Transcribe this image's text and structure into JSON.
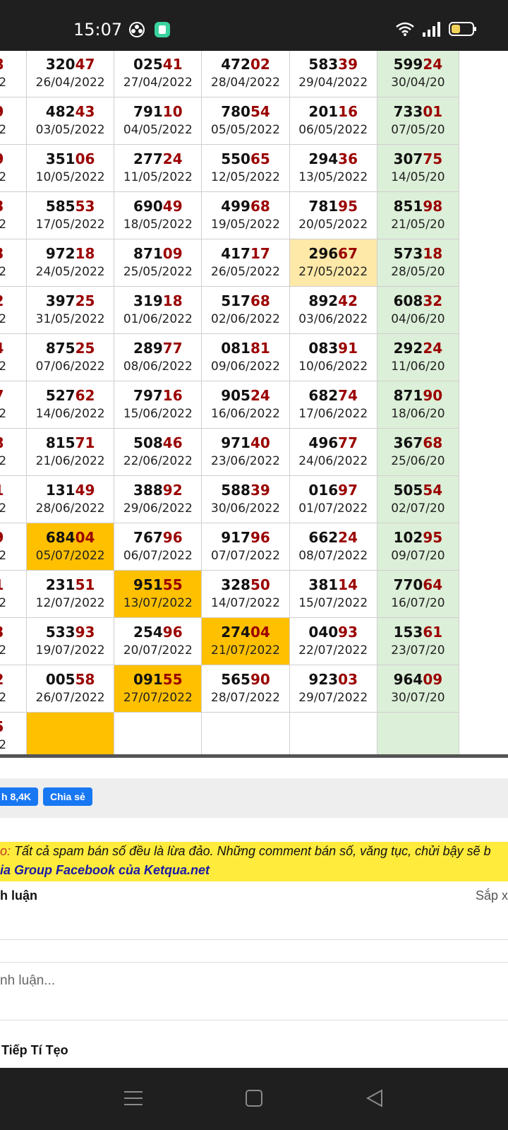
{
  "status": {
    "time": "15:07"
  },
  "rows": [
    [
      {
        "n": "368",
        "d": "/2022"
      },
      {
        "n": "32047",
        "d": "26/04/2022"
      },
      {
        "n": "02541",
        "d": "27/04/2022"
      },
      {
        "n": "47202",
        "d": "28/04/2022"
      },
      {
        "n": "58339",
        "d": "29/04/2022"
      },
      {
        "n": "59924",
        "d": "30/04/20"
      }
    ],
    [
      {
        "n": "479",
        "d": "/2022"
      },
      {
        "n": "48243",
        "d": "03/05/2022"
      },
      {
        "n": "79110",
        "d": "04/05/2022"
      },
      {
        "n": "78054",
        "d": "05/05/2022"
      },
      {
        "n": "20116",
        "d": "06/05/2022"
      },
      {
        "n": "73301",
        "d": "07/05/20"
      }
    ],
    [
      {
        "n": "559",
        "d": "/2022"
      },
      {
        "n": "35106",
        "d": "10/05/2022"
      },
      {
        "n": "27724",
        "d": "11/05/2022"
      },
      {
        "n": "55065",
        "d": "12/05/2022"
      },
      {
        "n": "29436",
        "d": "13/05/2022"
      },
      {
        "n": "30775",
        "d": "14/05/20"
      }
    ],
    [
      {
        "n": "713",
        "d": "/2022"
      },
      {
        "n": "58553",
        "d": "17/05/2022"
      },
      {
        "n": "69049",
        "d": "18/05/2022"
      },
      {
        "n": "49968",
        "d": "19/05/2022"
      },
      {
        "n": "78195",
        "d": "20/05/2022"
      },
      {
        "n": "85198",
        "d": "21/05/20"
      }
    ],
    [
      {
        "n": "213",
        "d": "/2022"
      },
      {
        "n": "97218",
        "d": "24/05/2022"
      },
      {
        "n": "87109",
        "d": "25/05/2022"
      },
      {
        "n": "41717",
        "d": "26/05/2022"
      },
      {
        "n": "29667",
        "d": "27/05/2022",
        "hl": "light"
      },
      {
        "n": "57318",
        "d": "28/05/20"
      }
    ],
    [
      {
        "n": "512",
        "d": "/2022"
      },
      {
        "n": "39725",
        "d": "31/05/2022"
      },
      {
        "n": "31918",
        "d": "01/06/2022"
      },
      {
        "n": "51768",
        "d": "02/06/2022"
      },
      {
        "n": "89242",
        "d": "03/06/2022"
      },
      {
        "n": "60832",
        "d": "04/06/20"
      }
    ],
    [
      {
        "n": "584",
        "d": "/2022"
      },
      {
        "n": "87525",
        "d": "07/06/2022"
      },
      {
        "n": "28977",
        "d": "08/06/2022"
      },
      {
        "n": "08181",
        "d": "09/06/2022"
      },
      {
        "n": "08391",
        "d": "10/06/2022"
      },
      {
        "n": "29224",
        "d": "11/06/20"
      }
    ],
    [
      {
        "n": "927",
        "d": "/2022"
      },
      {
        "n": "52762",
        "d": "14/06/2022"
      },
      {
        "n": "79716",
        "d": "15/06/2022"
      },
      {
        "n": "90524",
        "d": "16/06/2022"
      },
      {
        "n": "68274",
        "d": "17/06/2022"
      },
      {
        "n": "87190",
        "d": "18/06/20"
      }
    ],
    [
      {
        "n": "308",
        "d": "/2022"
      },
      {
        "n": "81571",
        "d": "21/06/2022"
      },
      {
        "n": "50846",
        "d": "22/06/2022"
      },
      {
        "n": "97140",
        "d": "23/06/2022"
      },
      {
        "n": "49677",
        "d": "24/06/2022"
      },
      {
        "n": "36768",
        "d": "25/06/20"
      }
    ],
    [
      {
        "n": "171",
        "d": "/2022"
      },
      {
        "n": "13149",
        "d": "28/06/2022"
      },
      {
        "n": "38892",
        "d": "29/06/2022"
      },
      {
        "n": "58839",
        "d": "30/06/2022"
      },
      {
        "n": "01697",
        "d": "01/07/2022"
      },
      {
        "n": "50554",
        "d": "02/07/20"
      }
    ],
    [
      {
        "n": "239",
        "d": "/2022"
      },
      {
        "n": "68404",
        "d": "05/07/2022",
        "hl": "strong"
      },
      {
        "n": "76796",
        "d": "06/07/2022"
      },
      {
        "n": "91796",
        "d": "07/07/2022"
      },
      {
        "n": "66224",
        "d": "08/07/2022"
      },
      {
        "n": "10295",
        "d": "09/07/20"
      }
    ],
    [
      {
        "n": "301",
        "d": "/2022"
      },
      {
        "n": "23151",
        "d": "12/07/2022"
      },
      {
        "n": "95155",
        "d": "13/07/2022",
        "hl": "strong"
      },
      {
        "n": "32850",
        "d": "14/07/2022"
      },
      {
        "n": "38114",
        "d": "15/07/2022"
      },
      {
        "n": "77064",
        "d": "16/07/20"
      }
    ],
    [
      {
        "n": "713",
        "d": "/2022"
      },
      {
        "n": "53393",
        "d": "19/07/2022"
      },
      {
        "n": "25496",
        "d": "20/07/2022"
      },
      {
        "n": "27404",
        "d": "21/07/2022",
        "hl": "strong"
      },
      {
        "n": "04093",
        "d": "22/07/2022"
      },
      {
        "n": "15361",
        "d": "23/07/20"
      }
    ],
    [
      {
        "n": "502",
        "d": "/2022"
      },
      {
        "n": "00558",
        "d": "26/07/2022"
      },
      {
        "n": "09155",
        "d": "27/07/2022",
        "hl": "strong"
      },
      {
        "n": "56590",
        "d": "28/07/2022"
      },
      {
        "n": "92303",
        "d": "29/07/2022"
      },
      {
        "n": "96409",
        "d": "30/07/20"
      }
    ],
    [
      {
        "n": "555",
        "d": "/2022"
      },
      {
        "n": "",
        "d": "",
        "hl": "strong"
      },
      {
        "n": "",
        "d": ""
      },
      {
        "n": "",
        "d": ""
      },
      {
        "n": "",
        "d": ""
      },
      {
        "n": "",
        "d": ""
      }
    ]
  ],
  "share": {
    "like_label": "h 8,4K",
    "share_label": "Chia sẻ"
  },
  "notice": {
    "lead": "o:",
    "text": " Tất cả spam bán số đều là lừa đảo. Những comment bán số, văng tục, chửi bậy sẽ b",
    "line2": "ia Group Facebook của Ketqua.net"
  },
  "comments": {
    "header": "h luận",
    "sort": "Sắp x",
    "placeholder": "nh luận...",
    "first_user": "Tiếp Tí Tẹo"
  }
}
